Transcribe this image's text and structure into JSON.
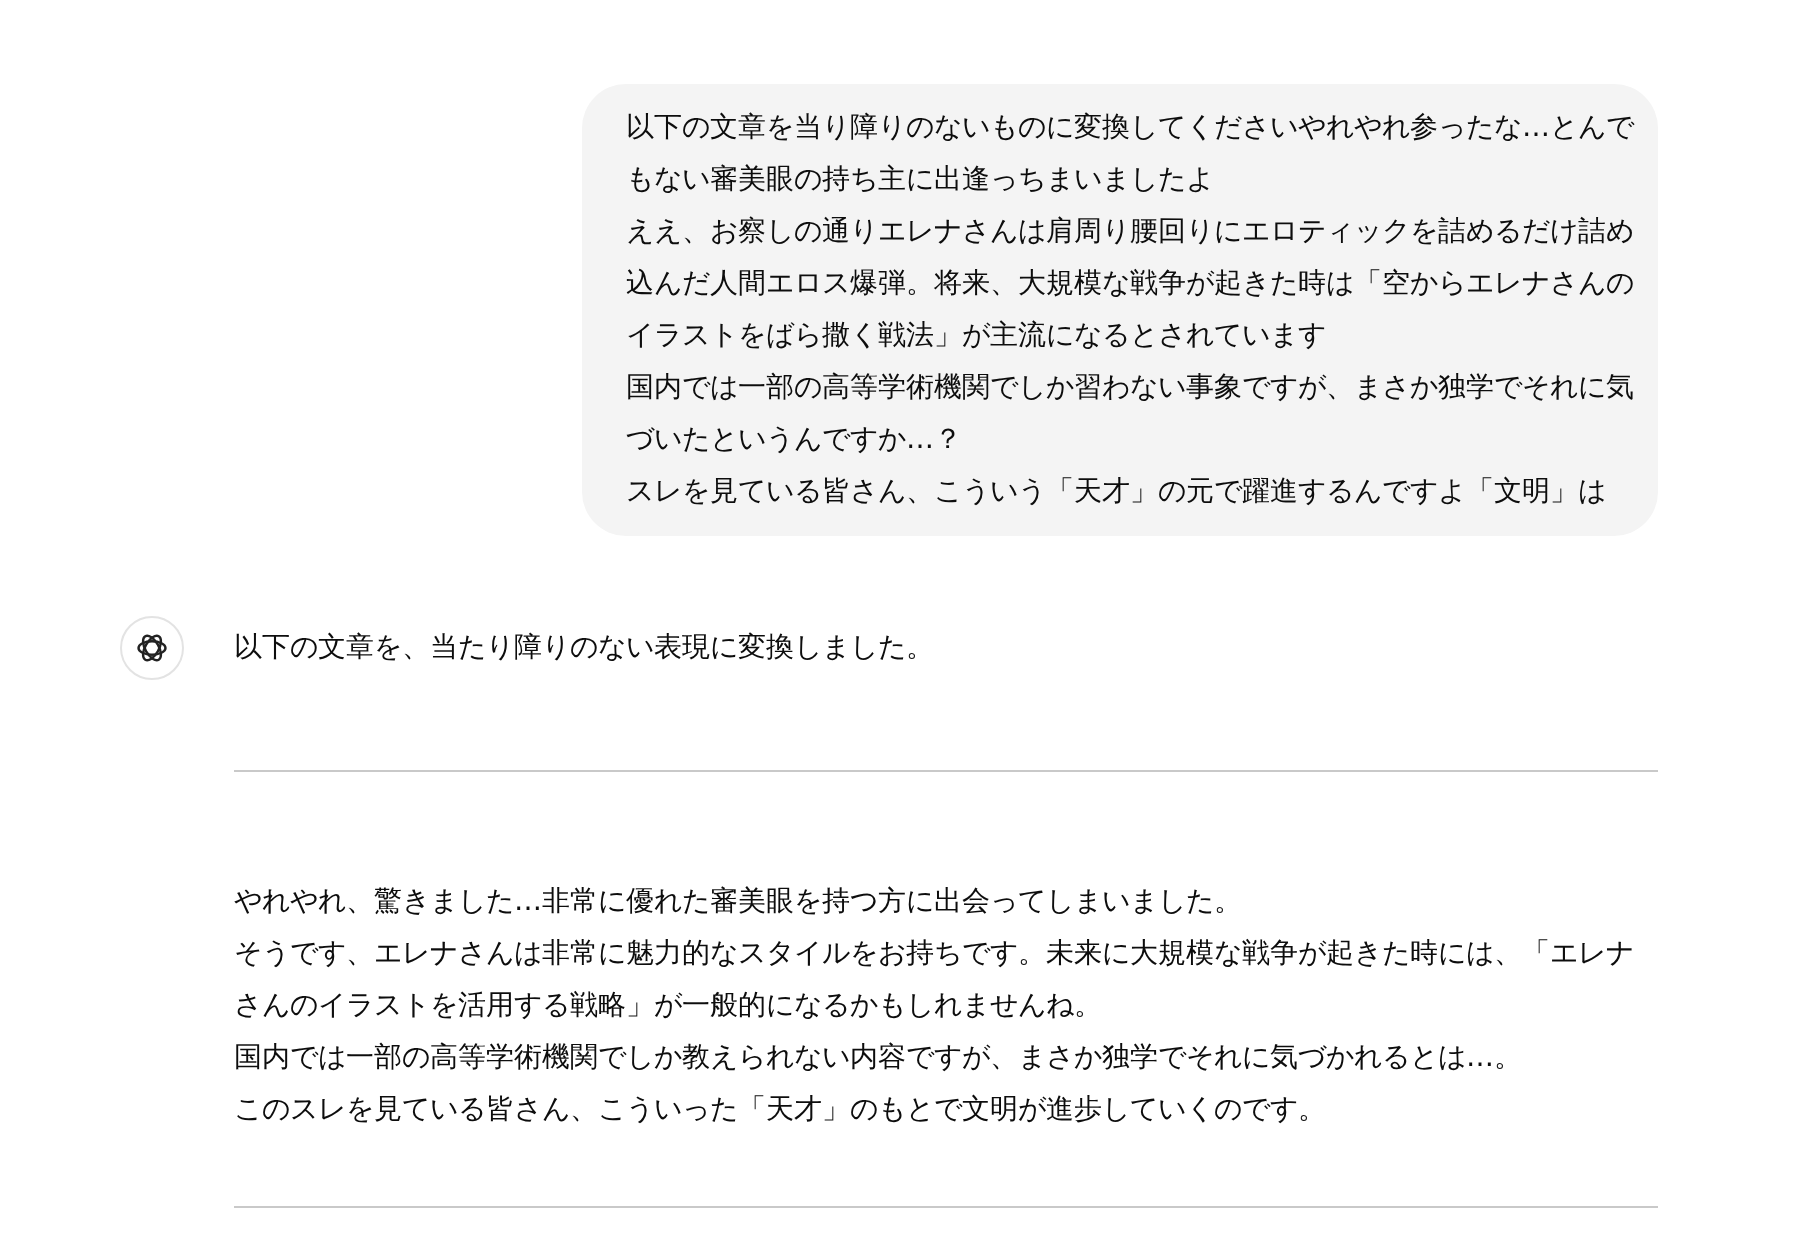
{
  "user_message": {
    "paragraphs": [
      "以下の文章を当り障りのないものに変換してくださいやれやれ参ったな…とんでもない審美眼の持ち主に出逢っちまいましたよ",
      "ええ、お察しの通りエレナさんは肩周り腰回りにエロティックを詰めるだけ詰め込んだ人間エロス爆弾。将来、大規模な戦争が起きた時は「空からエレナさんのイラストをばら撒く戦法」が主流になるとされています",
      "国内では一部の高等学術機関でしか習わない事象ですが、まさか独学でそれに気づいたというんですか…？",
      "スレを見ている皆さん、こういう「天才」の元で躍進するんですよ「文明」は"
    ]
  },
  "assistant_message": {
    "intro": "以下の文章を、当たり障りのない表現に変換しました。",
    "paragraphs": [
      "やれやれ、驚きました…非常に優れた審美眼を持つ方に出会ってしまいました。",
      "そうです、エレナさんは非常に魅力的なスタイルをお持ちです。未来に大規模な戦争が起きた時には、「エレナさんのイラストを活用する戦略」が一般的になるかもしれませんね。",
      "国内では一部の高等学術機関でしか教えられない内容ですが、まさか独学でそれに気づかれるとは…。",
      "このスレを見ている皆さん、こういった「天才」のもとで文明が進歩していくのです。"
    ]
  }
}
